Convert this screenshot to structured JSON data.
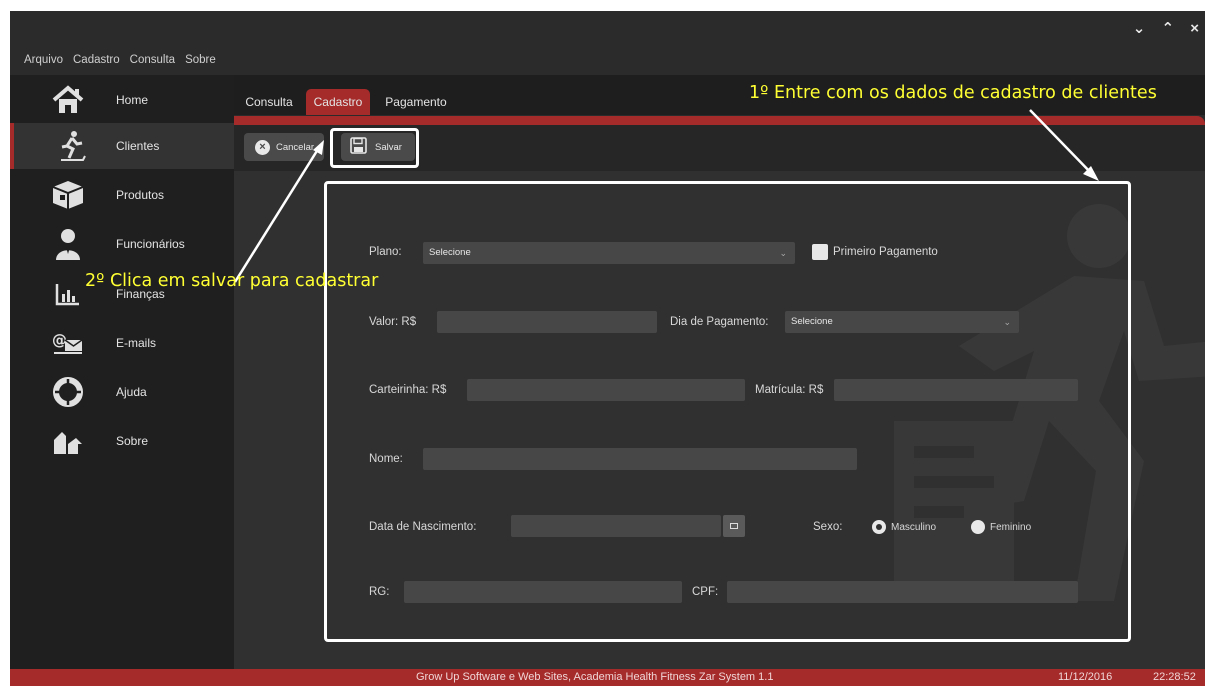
{
  "window": {
    "controls": "⌄ ⌃ ×"
  },
  "menubar": [
    "Arquivo",
    "Cadastro",
    "Consulta",
    "Sobre"
  ],
  "sidebar": {
    "items": [
      {
        "label": "Home",
        "icon": "house-icon"
      },
      {
        "label": "Clientes",
        "icon": "runner-icon",
        "active": true
      },
      {
        "label": "Produtos",
        "icon": "box-icon"
      },
      {
        "label": "Funcionários",
        "icon": "employee-icon"
      },
      {
        "label": "Finanças",
        "icon": "bar-chart-icon"
      },
      {
        "label": "E-mails",
        "icon": "email-icon"
      },
      {
        "label": "Ajuda",
        "icon": "lifebuoy-icon"
      },
      {
        "label": "Sobre",
        "icon": "about-icon"
      }
    ]
  },
  "tabs": [
    {
      "label": "Consulta"
    },
    {
      "label": "Cadastro",
      "active": true
    },
    {
      "label": "Pagamento"
    }
  ],
  "toolbar": {
    "cancel_label": "Cancelar",
    "save_label": "Salvar"
  },
  "form": {
    "plano_label": "Plano:",
    "plano_value": "Selecione",
    "primeiro_pagamento_label": "Primeiro Pagamento",
    "valor_label": "Valor: R$",
    "dia_pagamento_label": "Dia de Pagamento:",
    "dia_pagamento_value": "Selecione",
    "carteirinha_label": "Carteirinha: R$",
    "matricula_label": "Matrícula: R$",
    "nome_label": "Nome:",
    "nascimento_label": "Data de Nascimento:",
    "sexo_label": "Sexo:",
    "sexo_options": [
      "Masculino",
      "Feminino"
    ],
    "sexo_selected": "Masculino",
    "rg_label": "RG:",
    "cpf_label": "CPF:"
  },
  "status": {
    "credits": "Grow Up Software e Web Sites, Academia Health Fitness Zar System 1.1",
    "date": "11/12/2016",
    "time": "22:28:52"
  },
  "annotations": {
    "step1": "1º Entre com os dados de cadastro de clientes",
    "step2": "2º Clica em salvar para cadastrar"
  },
  "colors": {
    "accent": "#a52a2a",
    "annotation": "#ffff33",
    "background": "#2b2b2b"
  }
}
